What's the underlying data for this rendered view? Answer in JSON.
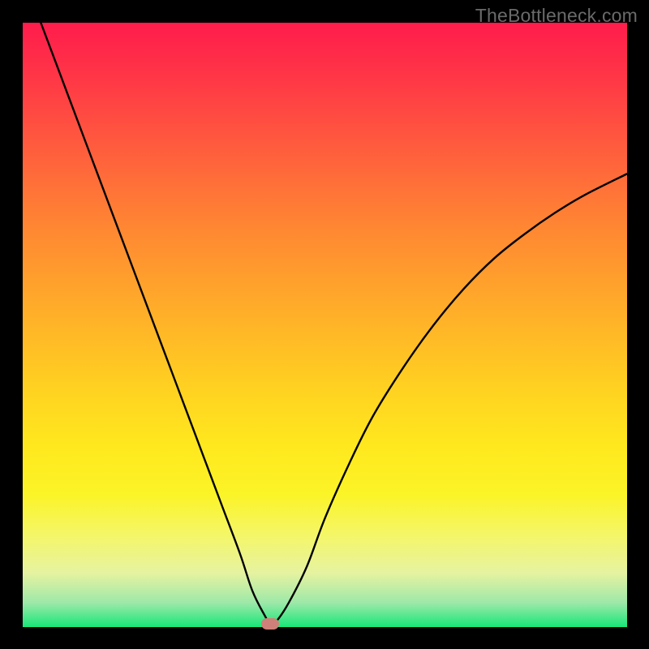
{
  "watermark": {
    "text": "TheBottleneck.com"
  },
  "colors": {
    "background": "#000000",
    "gradient_top": "#ff1c4c",
    "gradient_bottom": "#17e777",
    "curve": "#000000",
    "marker": "#cf8078"
  },
  "chart_data": {
    "type": "line",
    "title": "",
    "xlabel": "",
    "ylabel": "",
    "xlim": [
      0,
      100
    ],
    "ylim": [
      0,
      100
    ],
    "x": [
      0,
      3,
      6,
      9,
      12,
      15,
      18,
      21,
      24,
      27,
      30,
      33,
      36,
      38,
      40,
      41,
      42,
      44,
      47,
      50,
      54,
      58,
      63,
      68,
      73,
      78,
      83,
      88,
      93,
      100
    ],
    "values": [
      108,
      100,
      92,
      84,
      76,
      68,
      60,
      52,
      44,
      36,
      28,
      20,
      12,
      6,
      2,
      0.5,
      1,
      4,
      10,
      18,
      27,
      35,
      43,
      50,
      56,
      61,
      65,
      68.5,
      71.5,
      75
    ],
    "marker": {
      "x": 41,
      "y": 0.5,
      "label": ""
    }
  }
}
